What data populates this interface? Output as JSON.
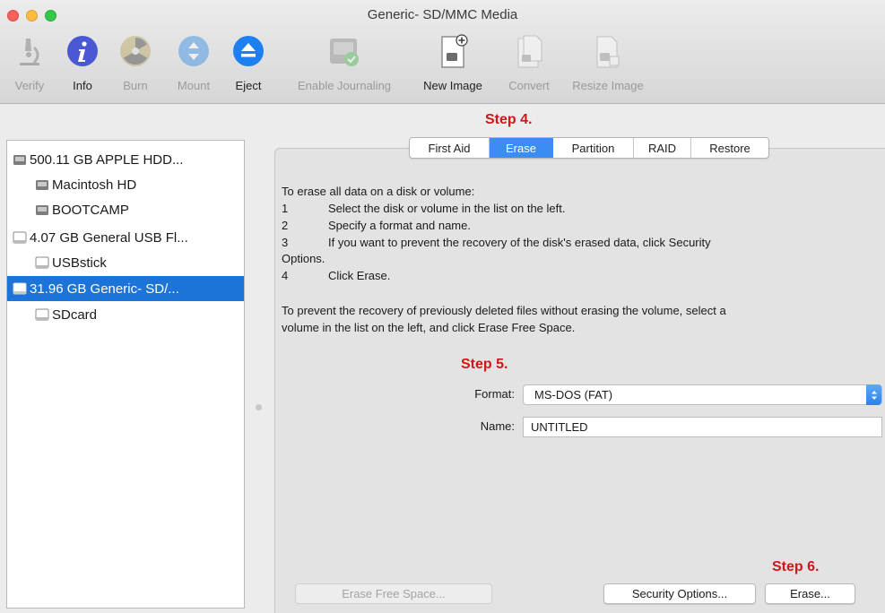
{
  "window": {
    "title": "Generic- SD/MMC Media"
  },
  "toolbar": {
    "items": [
      {
        "label": "Verify",
        "icon": "microscope-icon",
        "enabled": false
      },
      {
        "label": "Info",
        "icon": "info-icon",
        "enabled": true
      },
      {
        "label": "Burn",
        "icon": "radioactive-burn-icon",
        "enabled": false
      },
      {
        "label": "Mount",
        "icon": "mount-icon",
        "enabled": false
      },
      {
        "label": "Eject",
        "icon": "eject-icon",
        "enabled": true
      },
      {
        "label": "Enable Journaling",
        "icon": "journaling-disk-icon",
        "enabled": false
      },
      {
        "label": "New Image",
        "icon": "new-image-icon",
        "enabled": true
      },
      {
        "label": "Convert",
        "icon": "convert-icon",
        "enabled": false
      },
      {
        "label": "Resize Image",
        "icon": "resize-image-icon",
        "enabled": false
      }
    ]
  },
  "sidebar": {
    "items": [
      {
        "label": "500.11 GB APPLE HDD...",
        "level": 0,
        "icon": "internal-disk-icon",
        "selected": false
      },
      {
        "label": "Macintosh HD",
        "level": 1,
        "icon": "volume-icon",
        "selected": false
      },
      {
        "label": "BOOTCAMP",
        "level": 1,
        "icon": "volume-icon",
        "selected": false
      },
      {
        "label": "4.07 GB General USB Fl...",
        "level": 0,
        "icon": "external-disk-icon",
        "selected": false
      },
      {
        "label": "USBstick",
        "level": 1,
        "icon": "external-volume-icon",
        "selected": false
      },
      {
        "label": "31.96 GB Generic- SD/...",
        "level": 0,
        "icon": "external-disk-icon",
        "selected": true
      },
      {
        "label": "SDcard",
        "level": 1,
        "icon": "external-volume-icon",
        "selected": false
      }
    ]
  },
  "annotations": {
    "step4": "Step 4.",
    "step5": "Step 5.",
    "step6": "Step 6."
  },
  "tabs": [
    {
      "label": "First Aid",
      "active": false
    },
    {
      "label": "Erase",
      "active": true
    },
    {
      "label": "Partition",
      "active": false
    },
    {
      "label": "RAID",
      "active": false
    },
    {
      "label": "Restore",
      "active": false
    }
  ],
  "erase": {
    "intro": "To erase all data on a disk or volume:",
    "steps": [
      {
        "num": "1",
        "text": "Select the disk or volume in the list on the left."
      },
      {
        "num": "2",
        "text": "Specify a format and name."
      },
      {
        "num": "3",
        "text": "If you want to prevent the recovery of the disk's erased data, click Security",
        "cont": "Options."
      },
      {
        "num": "4",
        "text": "Click Erase."
      }
    ],
    "note_line1": "To prevent the recovery of previously deleted files without erasing the volume, select a",
    "note_line2": "volume in the list on the left, and click Erase Free Space.",
    "format_label": "Format:",
    "format_value": "MS-DOS (FAT)",
    "name_label": "Name:",
    "name_value": "UNTITLED",
    "erase_free_space_button": "Erase Free Space...",
    "security_options_button": "Security Options...",
    "erase_button": "Erase..."
  },
  "colors": {
    "accent": "#1d74d8",
    "annotation": "#d0161a"
  }
}
